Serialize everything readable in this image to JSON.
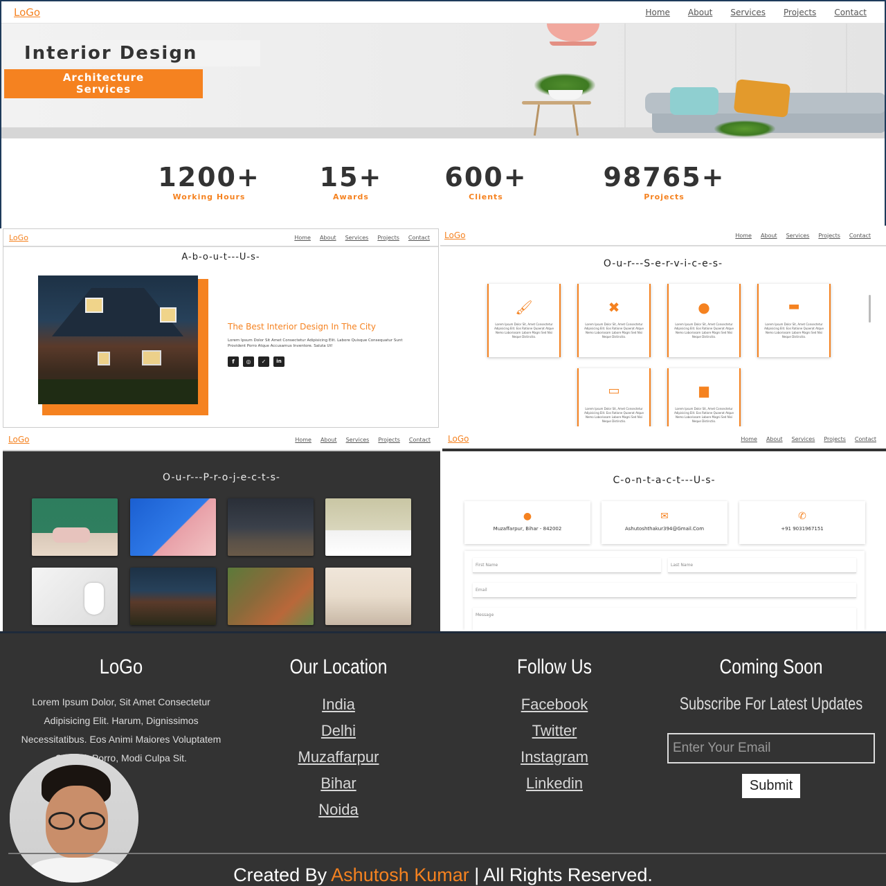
{
  "brand": {
    "logo": "LoGo",
    "accent": "#f58220",
    "dark_bg": "#333333"
  },
  "nav": {
    "home": "Home",
    "about": "About",
    "services": "Services",
    "projects": "Projects",
    "contact": "Contact"
  },
  "hero": {
    "title": "Interior Design",
    "subtitle_line1": "Architecture",
    "subtitle_line2": "Services"
  },
  "stats": [
    {
      "value": "1200+",
      "label": "Working Hours"
    },
    {
      "value": "15+",
      "label": "Awards"
    },
    {
      "value": "600+",
      "label": "Clients"
    },
    {
      "value": "98765+",
      "label": "Projects"
    }
  ],
  "about": {
    "title": "A-b-o-u-t---U-s-",
    "heading": "The Best Interior Design In The City",
    "text": "Lorem Ipsum Dolor Sit Amet Consectetur Adipisicing Elit. Labore Quisque Consequatur Sunt Provident Porro Atque Accusamus Inventore. Saluta Ut!",
    "social_icons": [
      "facebook-icon",
      "instagram-icon",
      "twitter-icon",
      "linkedin-icon"
    ]
  },
  "services": {
    "title": "O-u-r---S-e-r-v-i-c-e-s-",
    "cards": [
      {
        "icon": "paint-brush-icon",
        "text": "Lorem Ipsum Dolor Sit, Amet Consectetur Adipisicing Elit. Eos Ratione Quaerat Atque Nemo Laboriosam Labore Magni Sed Nisi Neque Distinctio."
      },
      {
        "icon": "tools-icon",
        "text": "Lorem Ipsum Dolor Sit, Amet Consectetur Adipisicing Elit. Eos Ratione Quaerat Atque Nemo Laboriosam Labore Magni Sed Nisi Neque Distinctio."
      },
      {
        "icon": "user-icon",
        "text": "Lorem Ipsum Dolor Sit, Amet Consectetur Adipisicing Elit. Eos Ratione Quaerat Atque Nemo Laboriosam Labore Magni Sed Nisi Neque Distinctio."
      },
      {
        "icon": "sofa-icon",
        "text": "Lorem Ipsum Dolor Sit, Amet Consectetur Adipisicing Elit. Eos Ratione Quaerat Atque Nemo Laboriosam Labore Magni Sed Nisi Neque Distinctio."
      },
      {
        "icon": "bed-icon",
        "text": "Lorem Ipsum Dolor Sit, Amet Consectetur Adipisicing Elit. Eos Ratione Quaerat Atque Nemo Laboriosam Labore Magni Sed Nisi Neque Distinctio."
      },
      {
        "icon": "bath-icon",
        "text": "Lorem Ipsum Dolor Sit, Amet Consectetur Adipisicing Elit. Eos Ratione Quaerat Atque Nemo Laboriosam Labore Magni Sed Nisi Neque Distinctio."
      }
    ]
  },
  "projects": {
    "title": "O-u-r---P-r-o-j-e-c-t-s-"
  },
  "contact": {
    "title": "C-o-n-t-a-c-t---U-s-",
    "address": "Muzaffarpur, Bihar - 842002",
    "email": "Ashutoshthakur394@Gmail.Com",
    "phone": "+91 9031967151",
    "first_name_placeholder": "First Name",
    "last_name_placeholder": "Last Name",
    "email_placeholder": "Email",
    "message_placeholder": "Message"
  },
  "footer": {
    "logo": "LoGo",
    "about_text": "Lorem Ipsum Dolor, Sit Amet Consectetur Adipisicing Elit. Harum, Dignissimos Necessitatibus. Eos Animi Maiores Voluptatem Suscipit Porro, Modi Culpa Sit.",
    "location_title": "Our Location",
    "locations": [
      "India",
      "Delhi",
      "Muzaffarpur",
      "Bihar",
      "Noida"
    ],
    "follow_title": "Follow Us",
    "follow_links": [
      "Facebook",
      "Twitter",
      "Instagram",
      "Linkedin"
    ],
    "coming_title": "Coming Soon",
    "subscribe_text": "Subscribe For Latest Updates",
    "email_placeholder": "Enter Your Email",
    "submit_label": "Submit",
    "credit_prefix": "Created By",
    "credit_name": "Ashutosh Kumar",
    "credit_suffix": "| All Rights Reserved."
  }
}
